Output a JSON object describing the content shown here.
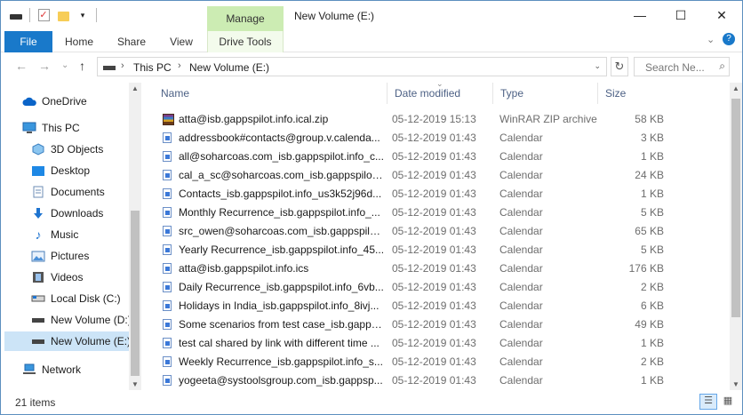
{
  "window": {
    "title": "New Volume (E:)",
    "minimize": "—",
    "maximize": "☐",
    "close": "✕"
  },
  "ribbon": {
    "contextual_group": "Manage",
    "tabs": [
      "File",
      "Home",
      "Share",
      "View",
      "Drive Tools"
    ],
    "expand_icon": "⌄",
    "help_icon": "?"
  },
  "address": {
    "crumbs": [
      "This PC",
      "New Volume (E:)"
    ],
    "search_placeholder": "Search Ne...",
    "back": "←",
    "forward": "→",
    "recent": "⌄",
    "up": "↑",
    "refresh": "↻"
  },
  "nav_pane": {
    "items": [
      {
        "label": "OneDrive",
        "icon": "cloud-icon"
      },
      {
        "label": "This PC",
        "icon": "computer-icon"
      },
      {
        "label": "3D Objects",
        "icon": "cube-icon"
      },
      {
        "label": "Desktop",
        "icon": "desktop-icon"
      },
      {
        "label": "Documents",
        "icon": "documents-icon"
      },
      {
        "label": "Downloads",
        "icon": "download-icon"
      },
      {
        "label": "Music",
        "icon": "music-icon"
      },
      {
        "label": "Pictures",
        "icon": "pictures-icon"
      },
      {
        "label": "Videos",
        "icon": "videos-icon"
      },
      {
        "label": "Local Disk (C:)",
        "icon": "drive-icon"
      },
      {
        "label": "New Volume (D:)",
        "icon": "drive-icon"
      },
      {
        "label": "New Volume (E:)",
        "icon": "drive-icon"
      },
      {
        "label": "Network",
        "icon": "network-icon"
      }
    ]
  },
  "columns": {
    "name": "Name",
    "date": "Date modified",
    "type": "Type",
    "size": "Size"
  },
  "files": [
    {
      "name": "atta@isb.gappspilot.info.ical.zip",
      "date": "05-12-2019 15:13",
      "type": "WinRAR ZIP archive",
      "size": "58 KB",
      "icon": "zip"
    },
    {
      "name": "addressbook#contacts@group.v.calenda...",
      "date": "05-12-2019 01:43",
      "type": "Calendar",
      "size": "3 KB",
      "icon": "cal"
    },
    {
      "name": "all@soharcoas.com_isb.gappspilot.info_c...",
      "date": "05-12-2019 01:43",
      "type": "Calendar",
      "size": "1 KB",
      "icon": "cal"
    },
    {
      "name": "cal_a_sc@soharcoas.com_isb.gappspilot....",
      "date": "05-12-2019 01:43",
      "type": "Calendar",
      "size": "24 KB",
      "icon": "cal"
    },
    {
      "name": "Contacts_isb.gappspilot.info_us3k52j96d...",
      "date": "05-12-2019 01:43",
      "type": "Calendar",
      "size": "1 KB",
      "icon": "cal"
    },
    {
      "name": "Monthly Recurrence_isb.gappspilot.info_...",
      "date": "05-12-2019 01:43",
      "type": "Calendar",
      "size": "5 KB",
      "icon": "cal"
    },
    {
      "name": "src_owen@soharcoas.com_isb.gappspilot....",
      "date": "05-12-2019 01:43",
      "type": "Calendar",
      "size": "65 KB",
      "icon": "cal"
    },
    {
      "name": "Yearly Recurrence_isb.gappspilot.info_45...",
      "date": "05-12-2019 01:43",
      "type": "Calendar",
      "size": "5 KB",
      "icon": "cal"
    },
    {
      "name": "atta@isb.gappspilot.info.ics",
      "date": "05-12-2019 01:43",
      "type": "Calendar",
      "size": "176 KB",
      "icon": "cal"
    },
    {
      "name": "Daily Recurrence_isb.gappspilot.info_6vb...",
      "date": "05-12-2019 01:43",
      "type": "Calendar",
      "size": "2 KB",
      "icon": "cal"
    },
    {
      "name": "Holidays in India_isb.gappspilot.info_8ivj...",
      "date": "05-12-2019 01:43",
      "type": "Calendar",
      "size": "6 KB",
      "icon": "cal"
    },
    {
      "name": "Some scenarios from test case_isb.gapps...",
      "date": "05-12-2019 01:43",
      "type": "Calendar",
      "size": "49 KB",
      "icon": "cal"
    },
    {
      "name": "test cal shared by link with different time ...",
      "date": "05-12-2019 01:43",
      "type": "Calendar",
      "size": "1 KB",
      "icon": "cal"
    },
    {
      "name": "Weekly Recurrence_isb.gappspilot.info_s...",
      "date": "05-12-2019 01:43",
      "type": "Calendar",
      "size": "2 KB",
      "icon": "cal"
    },
    {
      "name": "yogeeta@systoolsgroup.com_isb.gappsp...",
      "date": "05-12-2019 01:43",
      "type": "Calendar",
      "size": "1 KB",
      "icon": "cal"
    }
  ],
  "status": {
    "item_count": "21 items"
  },
  "colors": {
    "file_tab": "#1979ca",
    "manage_tab": "#ccecb3",
    "selection": "#cce4f7",
    "header_text": "#4d6185"
  }
}
